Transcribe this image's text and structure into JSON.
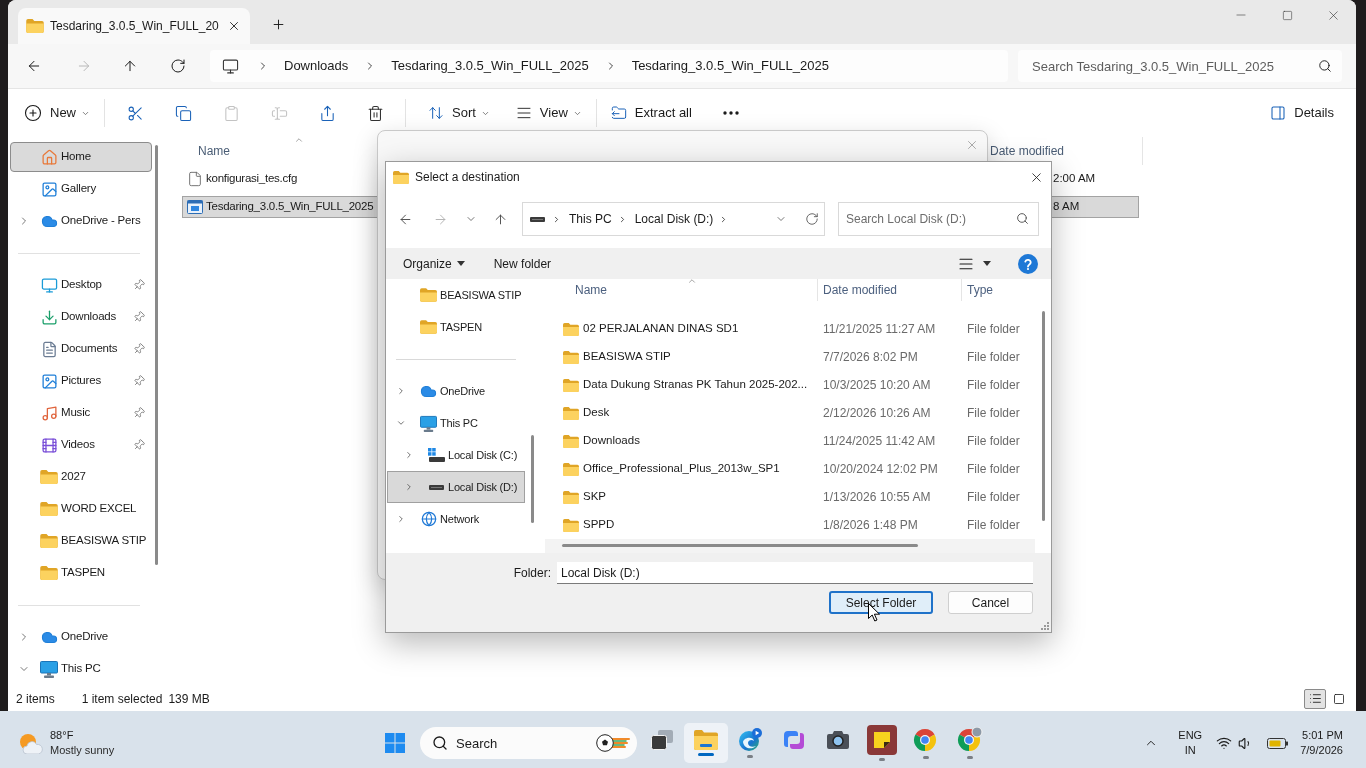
{
  "explorer": {
    "tab": {
      "title": "Tesdaring_3.0.5_Win_FULL_20"
    },
    "nav_buttons": [
      {
        "kind": "back",
        "disabled": false
      },
      {
        "kind": "forward",
        "disabled": true
      },
      {
        "kind": "up",
        "disabled": false
      },
      {
        "kind": "refresh",
        "disabled": false
      }
    ],
    "breadcrumbs": [
      "Downloads",
      "Tesdaring_3.0.5_Win_FULL_2025",
      "Tesdaring_3.0.5_Win_FULL_2025"
    ],
    "search": {
      "placeholder": "Search Tesdaring_3.0.5_Win_FULL_2025"
    },
    "toolbar": [
      {
        "kind": "new",
        "label": "New",
        "disabled": false
      },
      {
        "kind": "separator"
      },
      {
        "kind": "cut",
        "disabled": false
      },
      {
        "kind": "copy",
        "disabled": false
      },
      {
        "kind": "paste",
        "disabled": true
      },
      {
        "kind": "rename",
        "disabled": true
      },
      {
        "kind": "share",
        "disabled": false
      },
      {
        "kind": "delete",
        "disabled": false
      },
      {
        "kind": "separator"
      },
      {
        "kind": "sort",
        "label": "Sort",
        "disabled": false
      },
      {
        "kind": "view",
        "label": "View",
        "disabled": false
      },
      {
        "kind": "separator"
      },
      {
        "kind": "extract",
        "label": "Extract all",
        "disabled": false
      },
      {
        "kind": "more",
        "disabled": false
      }
    ],
    "details_button": {
      "label": "Details"
    },
    "sidebar": {
      "sections": [
        {
          "items": [
            {
              "kind": "home",
              "label": "Home",
              "selected": true,
              "pinned": false
            },
            {
              "kind": "gallery",
              "label": "Gallery",
              "selected": false,
              "pinned": false
            },
            {
              "kind": "cloud",
              "label": "OneDrive - Pers",
              "selected": false,
              "pinned": false,
              "expanded": false
            }
          ]
        },
        {
          "items": [
            {
              "kind": "desktop",
              "label": "Desktop",
              "selected": false,
              "pinned": true
            },
            {
              "kind": "downloads",
              "label": "Downloads",
              "selected": false,
              "pinned": true
            },
            {
              "kind": "documents",
              "label": "Documents",
              "selected": false,
              "pinned": true
            },
            {
              "kind": "pictures",
              "label": "Pictures",
              "selected": false,
              "pinned": true
            },
            {
              "kind": "music",
              "label": "Music",
              "selected": false,
              "pinned": true
            },
            {
              "kind": "videos",
              "label": "Videos",
              "selected": false,
              "pinned": true
            },
            {
              "kind": "folder",
              "label": "2027",
              "selected": false,
              "pinned": false
            },
            {
              "kind": "folder",
              "label": "WORD EXCEL",
              "selected": false,
              "pinned": false
            },
            {
              "kind": "folder",
              "label": "BEASISWA STIP",
              "selected": false,
              "pinned": false
            },
            {
              "kind": "folder",
              "label": "TASPEN",
              "selected": false,
              "pinned": false
            }
          ]
        },
        {
          "items": [
            {
              "kind": "cloud",
              "label": "OneDrive",
              "selected": false,
              "pinned": false,
              "expanded": false
            },
            {
              "kind": "pc",
              "label": "This PC",
              "selected": false,
              "pinned": false,
              "expanded": true
            }
          ]
        }
      ]
    },
    "file_list": {
      "columns": [
        {
          "label": "Name",
          "sorted": true
        },
        {
          "label": "Date modified",
          "sorted": false
        }
      ],
      "rows": [
        {
          "kind": "file",
          "name": "konfigurasi_tes.cfg",
          "modified": "2:00 AM",
          "selected": false
        },
        {
          "kind": "app",
          "name": "Tesdaring_3.0.5_Win_FULL_2025",
          "modified": "8 AM",
          "selected": true
        }
      ]
    },
    "status_bar": {
      "item_count": "2 items",
      "selection": "1 item selected",
      "size": "139 MB",
      "views": [
        {
          "kind": "details",
          "selected": true
        },
        {
          "kind": "tiles",
          "selected": false
        }
      ]
    }
  },
  "dialog": {
    "title": "Select a destination",
    "nav_buttons": [
      {
        "kind": "back",
        "disabled": false
      },
      {
        "kind": "forward",
        "disabled": true
      },
      {
        "kind": "recent",
        "disabled": false
      },
      {
        "kind": "up",
        "disabled": false
      }
    ],
    "breadcrumbs": [
      "This PC",
      "Local Disk (D:)"
    ],
    "search": {
      "placeholder": "Search Local Disk (D:)"
    },
    "toolbar": {
      "organize": "Organize",
      "new_folder": "New folder"
    },
    "tree": {
      "sections": [
        {
          "items": [
            {
              "kind": "folder",
              "label": "BEASISWA STIP",
              "selected": false
            },
            {
              "kind": "folder",
              "label": "TASPEN",
              "selected": false
            }
          ]
        },
        {
          "items": [
            {
              "kind": "cloud",
              "label": "OneDrive",
              "selected": false,
              "expanded": false
            },
            {
              "kind": "pc",
              "label": "This PC",
              "selected": false,
              "expanded": true,
              "children": [
                {
                  "kind": "system-drive",
                  "label": "Local Disk (C:)",
                  "selected": false,
                  "expanded": false
                },
                {
                  "kind": "drive",
                  "label": "Local Disk (D:)",
                  "selected": true,
                  "expanded": false
                }
              ]
            },
            {
              "kind": "network",
              "label": "Network",
              "selected": false,
              "expanded": false
            }
          ]
        }
      ]
    },
    "columns": [
      {
        "label": "Name",
        "sorted": true
      },
      {
        "label": "Date modified",
        "sorted": false
      },
      {
        "label": "Type",
        "sorted": false
      }
    ],
    "rows": [
      {
        "name": "02 PERJALANAN DINAS SD1",
        "modified": "11/21/2025 11:27 AM",
        "type": "File folder",
        "selected": false
      },
      {
        "name": "BEASISWA STIP",
        "modified": "7/7/2026 8:02 PM",
        "type": "File folder",
        "selected": false
      },
      {
        "name": "Data Dukung Stranas PK Tahun 2025-202...",
        "modified": "10/3/2025 10:20 AM",
        "type": "File folder",
        "selected": false
      },
      {
        "name": "Desk",
        "modified": "2/12/2026 10:26 AM",
        "type": "File folder",
        "selected": false
      },
      {
        "name": "Downloads",
        "modified": "11/24/2025 11:42 AM",
        "type": "File folder",
        "selected": false
      },
      {
        "name": "Office_Professional_Plus_2013w_SP1",
        "modified": "10/20/2024 12:02 PM",
        "type": "File folder",
        "selected": false
      },
      {
        "name": "SKP",
        "modified": "1/13/2026 10:55 AM",
        "type": "File folder",
        "selected": false
      },
      {
        "name": "SPPD",
        "modified": "1/8/2026 1:48 PM",
        "type": "File folder",
        "selected": false
      }
    ],
    "folder_field": {
      "label": "Folder:",
      "value": "Local Disk (D:)"
    },
    "buttons": [
      {
        "kind": "primary",
        "label": "Select Folder"
      },
      {
        "kind": "secondary",
        "label": "Cancel"
      }
    ]
  },
  "taskbar": {
    "weather": {
      "temperature": "88°F",
      "condition": "Mostly sunny"
    },
    "search": {
      "placeholder": "Search"
    },
    "apps": [
      {
        "kind": "task-view",
        "running": false,
        "selected": false
      },
      {
        "kind": "file-explorer",
        "running": true,
        "selected": true
      },
      {
        "kind": "edge",
        "running": true,
        "selected": false
      },
      {
        "kind": "copilot",
        "running": false,
        "selected": false
      },
      {
        "kind": "camera",
        "running": false,
        "selected": false
      },
      {
        "kind": "sticky-notes",
        "running": true,
        "selected": false
      },
      {
        "kind": "chrome",
        "running": true,
        "selected": false
      },
      {
        "kind": "chrome-profile",
        "running": true,
        "selected": false
      }
    ],
    "tray": {
      "language": "ENG",
      "region": "IN",
      "time": "5:01 PM",
      "date": "7/9/2026"
    }
  }
}
